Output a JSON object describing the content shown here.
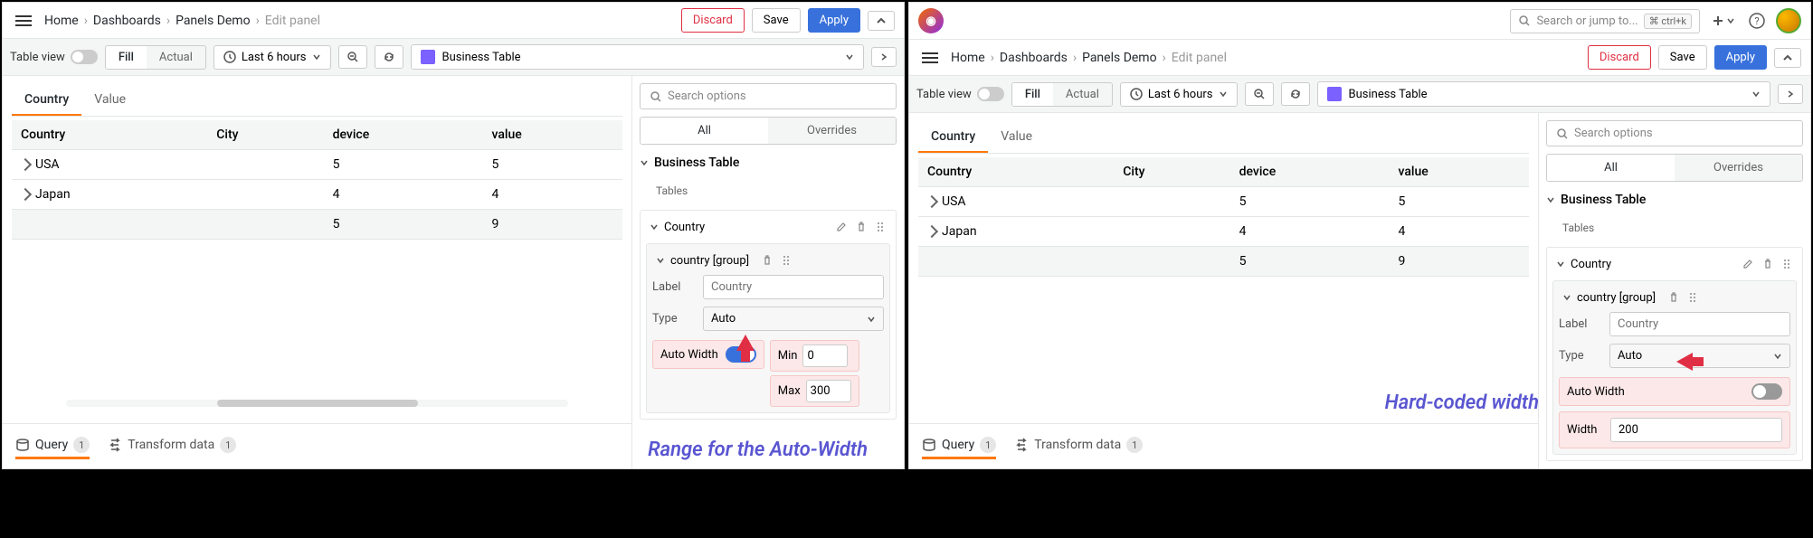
{
  "breadcrumb": {
    "home": "Home",
    "dashboards": "Dashboards",
    "demo": "Panels Demo",
    "edit": "Edit panel"
  },
  "actions": {
    "discard": "Discard",
    "save": "Save",
    "apply": "Apply"
  },
  "global_search": {
    "placeholder": "Search or jump to...",
    "shortcut": "ctrl+k"
  },
  "toolbar": {
    "table_view": "Table view",
    "fill": "Fill",
    "actual": "Actual",
    "time": "Last 6 hours",
    "viz": "Business Table"
  },
  "tabs": {
    "country": "Country",
    "value": "Value"
  },
  "table": {
    "headers": {
      "country": "Country",
      "city": "City",
      "device": "device",
      "value": "value"
    },
    "rows": [
      {
        "country": "USA",
        "device": "5",
        "value": "5"
      },
      {
        "country": "Japan",
        "device": "4",
        "value": "4"
      }
    ],
    "sum": {
      "device": "5",
      "value": "9"
    }
  },
  "bottom": {
    "query": "Query",
    "query_count": "1",
    "transform": "Transform data",
    "transform_count": "1"
  },
  "right": {
    "search_placeholder": "Search options",
    "all": "All",
    "overrides": "Overrides",
    "section": "Business Table",
    "tables": "Tables",
    "country": "Country",
    "group": "country [group]",
    "label_label": "Label",
    "label_value": "Country",
    "type_label": "Type",
    "type_value": "Auto",
    "auto_width": "Auto Width",
    "min_label": "Min",
    "min_value": "0",
    "max_label": "Max",
    "max_value": "300",
    "width_label": "Width",
    "width_value": "200"
  },
  "annotations": {
    "left": "Range for the Auto-Width",
    "right": "Hard-coded width"
  }
}
